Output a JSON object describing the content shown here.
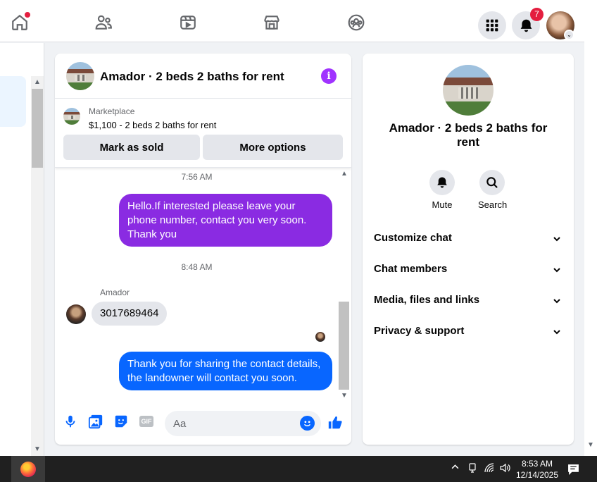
{
  "topnav": {
    "icons": [
      "home-icon",
      "friends-icon",
      "video-icon",
      "marketplace-icon",
      "groups-icon"
    ],
    "menu_icon": "grid-menu-icon",
    "notifications_icon": "bell-icon",
    "notifications_count": "7",
    "profile_chevron": "⌄"
  },
  "chat": {
    "title": "Amador · 2 beds 2 baths for rent",
    "marketplace": {
      "label": "Marketplace",
      "listing": "$1,100 - 2 beds 2 baths for rent",
      "mark_sold_label": "Mark as sold",
      "more_options_label": "More options"
    },
    "messages": [
      {
        "type": "timestamp",
        "text": "7:56 AM"
      },
      {
        "type": "outgoing",
        "text": "Hello.If interested please leave your phone number, contact you very soon. Thank you",
        "color": "#8a2be2"
      },
      {
        "type": "timestamp",
        "text": "8:48 AM"
      },
      {
        "type": "sender",
        "text": "Amador"
      },
      {
        "type": "incoming",
        "text": "3017689464"
      },
      {
        "type": "outgoing",
        "text": "Thank you for sharing the contact details, the landowner will contact you soon.",
        "color": "#0866ff"
      }
    ],
    "composer": {
      "placeholder": "Aa",
      "icons": [
        "microphone-icon",
        "photo-icon",
        "sticker-icon",
        "gif-icon",
        "emoji-icon",
        "like-icon"
      ],
      "gif_label": "GIF"
    }
  },
  "info": {
    "title": "Amador · 2 beds 2 baths for rent",
    "actions": [
      {
        "label": "Mute",
        "icon": "bell-icon"
      },
      {
        "label": "Search",
        "icon": "search-icon"
      }
    ],
    "sections": [
      "Customize chat",
      "Chat members",
      "Media, files and links",
      "Privacy & support"
    ]
  },
  "taskbar": {
    "time": "8:53 AM",
    "date": "12/14/2025"
  },
  "colors": {
    "accent": "#0866ff",
    "purple": "#a033ff",
    "badge": "#e41e3f"
  }
}
